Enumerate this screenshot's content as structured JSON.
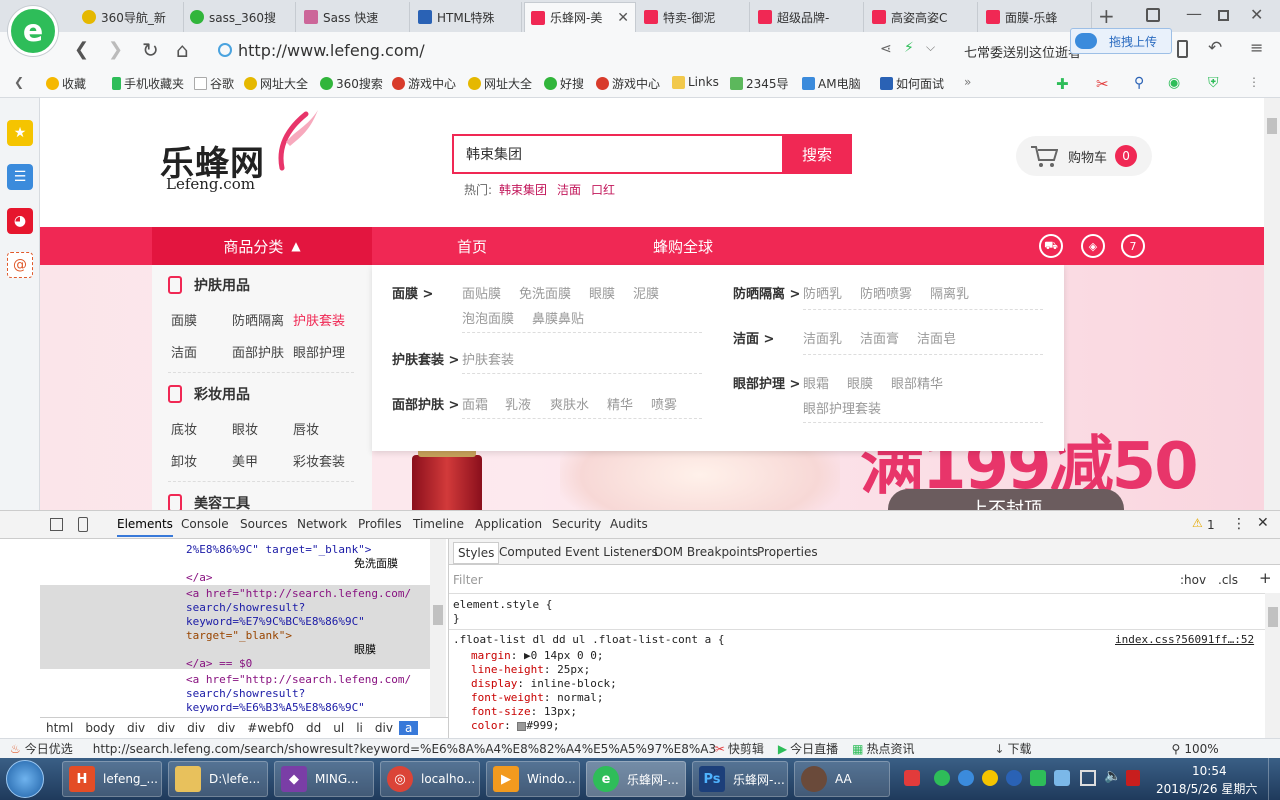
{
  "browser": {
    "tabs": [
      {
        "label": "360导航_新"
      },
      {
        "label": "sass_360搜"
      },
      {
        "label": "Sass 快速"
      },
      {
        "label": "HTML特殊"
      },
      {
        "label": "乐蜂网-美"
      },
      {
        "label": "特卖-御泥"
      },
      {
        "label": "超级品牌-"
      },
      {
        "label": "高姿高姿C"
      },
      {
        "label": "面膜-乐蜂"
      }
    ],
    "new_tab": "+",
    "url": "http://www.lefeng.com/",
    "news_ticker": "七常委送别这位逝者",
    "upload_label": "拖拽上传",
    "bookmarks": [
      "收藏",
      "手机收藏夹",
      "谷歌",
      "网址大全",
      "360搜索",
      "游戏中心",
      "网址大全",
      "好搜",
      "游戏中心",
      "Links",
      "2345导",
      "AM电脑",
      "如何面试"
    ],
    "bookmarks_more": "»"
  },
  "site": {
    "logo_cn": "乐蜂网",
    "logo_en": "Lefeng.com",
    "search_value": "韩束集团",
    "search_button": "搜索",
    "hot_label": "热门:",
    "hot_items": [
      "韩束集团",
      "洁面",
      "口红"
    ],
    "cart_label": "购物车",
    "cart_count": "0",
    "nav": {
      "categories_label": "商品分类",
      "home": "首页",
      "global": "蜂购全球"
    },
    "promo_text": "满199减50",
    "promo_button": "上不封顶",
    "category_groups": [
      {
        "title": "护肤用品",
        "items": [
          "面膜",
          "防晒隔离",
          "护肤套装",
          "洁面",
          "面部护肤",
          "眼部护理"
        ]
      },
      {
        "title": "彩妆用品",
        "items": [
          "底妆",
          "眼妆",
          "唇妆",
          "卸妆",
          "美甲",
          "彩妆套装"
        ]
      },
      {
        "title": "美容工具"
      }
    ],
    "popup": {
      "col1": [
        {
          "group": "面膜 >",
          "links": [
            "面贴膜",
            "免洗面膜",
            "眼膜",
            "泥膜",
            "泡泡面膜",
            "鼻膜鼻贴"
          ]
        },
        {
          "group": "护肤套装 >",
          "links": [
            "护肤套装"
          ]
        },
        {
          "group": "面部护肤 >",
          "links": [
            "面霜",
            "乳液",
            "爽肤水",
            "精华",
            "喷雾"
          ]
        }
      ],
      "col2": [
        {
          "group": "防晒隔离 >",
          "links": [
            "防晒乳",
            "防晒喷雾",
            "隔离乳"
          ]
        },
        {
          "group": "洁面 >",
          "links": [
            "洁面乳",
            "洁面膏",
            "洁面皂"
          ]
        },
        {
          "group": "眼部护理 >",
          "links": [
            "眼霜",
            "眼膜",
            "眼部精华",
            "眼部护理套装"
          ]
        }
      ]
    }
  },
  "devtools": {
    "tabs": [
      "Elements",
      "Console",
      "Sources",
      "Network",
      "Profiles",
      "Timeline",
      "Application",
      "Security",
      "Audits"
    ],
    "warnings": "1",
    "code_lines": [
      "2%E8%86%9C\" target=\"_blank\">",
      "免洗面膜",
      "</a>",
      "<a href=\"http://search.lefeng.com/",
      "search/showresult?",
      "keyword=%E7%9C%BC%E8%86%9C\"",
      "target=\"_blank\">",
      "眼膜",
      "</a> == $0",
      "<a href=\"http://search.lefeng.com/",
      "search/showresult?",
      "keyword=%E6%B3%A5%E8%86%9C\""
    ],
    "breadcrumbs": [
      "html",
      "body",
      "div",
      "div",
      "div",
      "div",
      "#webf0",
      "dd",
      "ul",
      "li",
      "div",
      "a"
    ],
    "style_tabs": [
      "Styles",
      "Computed",
      "Event Listeners",
      "DOM Breakpoints",
      "Properties"
    ],
    "filter_placeholder": "Filter",
    "hov": ":hov",
    "cls": ".cls",
    "element_style": "element.style {",
    "close_brace": "}",
    "rule_selector": ".float-list dl dd ul .float-list-cont a {",
    "rule_source": "index.css?56091ff…:52",
    "rule_props": [
      {
        "name": "margin",
        "value": "▶0 14px 0 0;"
      },
      {
        "name": "line-height",
        "value": "25px;"
      },
      {
        "name": "display",
        "value": "inline-block;"
      },
      {
        "name": "font-weight",
        "value": "normal;"
      },
      {
        "name": "font-size",
        "value": "13px;"
      },
      {
        "name": "color",
        "value": "#999;"
      }
    ]
  },
  "statusbar": {
    "left": "今日优选",
    "url": "http://search.lefeng.com/search/showresult?keyword=%E6%8A%A4%E8%82%A4%E5%A5%97%E8%A3%85",
    "items": [
      "快剪辑",
      "今日直播",
      "热点资讯",
      "下载"
    ],
    "zoom": "100%"
  },
  "taskbar": {
    "tasks": [
      "lefeng_...",
      "D:\\lefe...",
      "MING...",
      "localho...",
      "Windo...",
      "乐蜂网-...",
      "乐蜂网-...",
      "AA"
    ],
    "time": "10:54",
    "date": "2018/5/26 星期六"
  },
  "colors": {
    "accent": "#f02854",
    "accent_dark": "#e3153f"
  }
}
